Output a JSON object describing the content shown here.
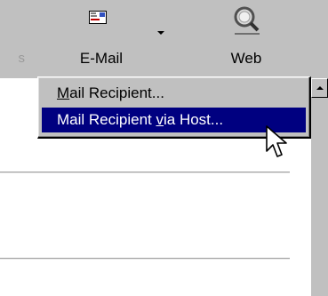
{
  "toolbar": {
    "partial_label": "s",
    "email_label": "E-Mail",
    "web_label": "Web",
    "icons": {
      "email": "email-envelope-icon",
      "web": "web-magnifier-icon",
      "dropdown": "dropdown-arrow-icon"
    }
  },
  "menu": {
    "items": [
      {
        "pre": "",
        "accel": "M",
        "post": "ail Recipient...",
        "highlighted": false
      },
      {
        "pre": "Mail Recipient ",
        "accel": "v",
        "post": "ia Host...",
        "highlighted": true
      }
    ]
  },
  "colors": {
    "face": "#c0c0c0",
    "highlight": "#000080",
    "highlight_text": "#ffffff"
  }
}
